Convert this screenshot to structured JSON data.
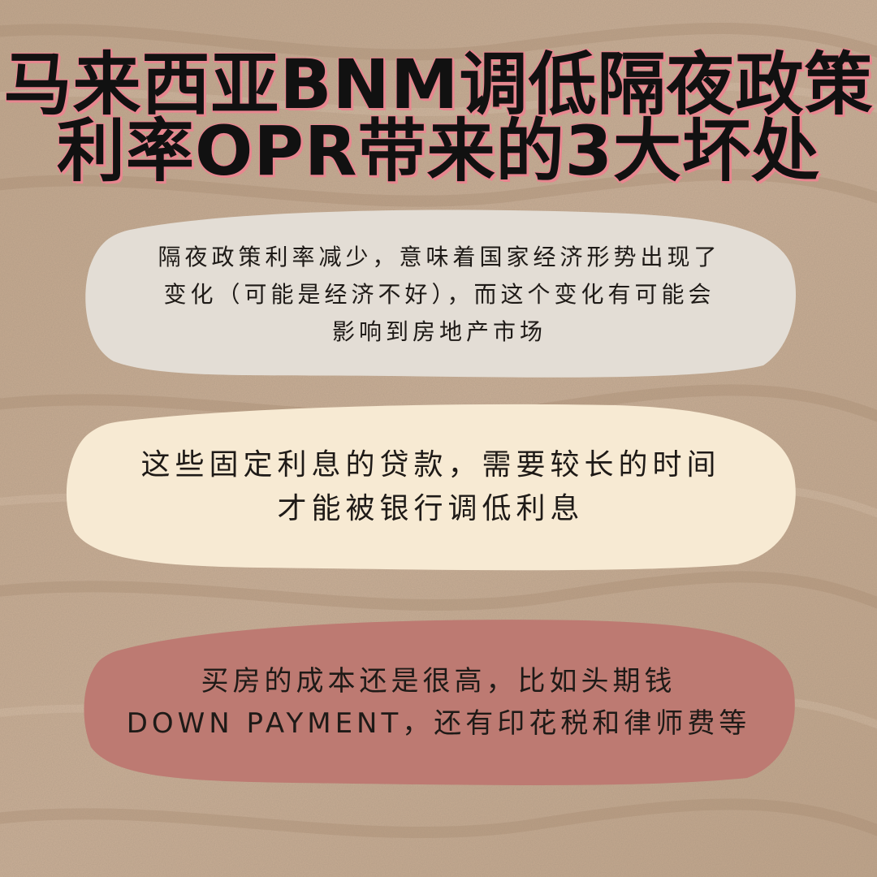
{
  "title": {
    "line1": "马来西亚BNM调低隔夜政策",
    "line2": "利率OPR带来的3大坏处"
  },
  "points": [
    {
      "lines": [
        "隔夜政策利率减少，意味着国家经济形势出现了",
        "变化（可能是经济不好），而这个变化有可能会",
        "影响到房地产市场"
      ],
      "color": "#e3ddd5"
    },
    {
      "lines": [
        "这些固定利息的贷款，需要较长的时间",
        "才能被银行调低利息"
      ],
      "color": "#f7ead3"
    },
    {
      "lines": [
        "买房的成本还是很高，比如头期钱",
        "DOWN PAYMENT，还有印花税和律师费等"
      ],
      "color": "#bd7a72"
    }
  ],
  "colors": {
    "background": "#c9ad93",
    "title_text": "#111111",
    "title_outline": "#e8868f"
  }
}
